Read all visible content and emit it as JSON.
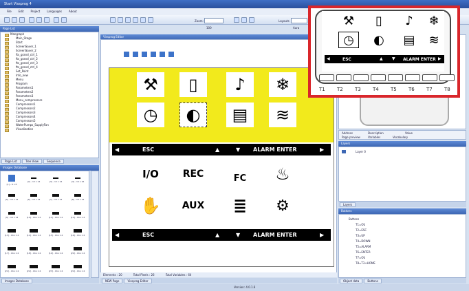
{
  "window": {
    "title": "Start Vissprog 4"
  },
  "menu": [
    "File",
    "Edit",
    "Project",
    "Languages",
    "About"
  ],
  "toolbar": {
    "zoom_label": "Zoom:",
    "zoom_value": "100",
    "layouts_label": "Layouts",
    "layouts_value": "Aura"
  },
  "page_list": {
    "title": "Page List",
    "items": [
      "Mangraph",
      "Main_Stage",
      "Start",
      "ScreenSaver_1",
      "ScreenSaver_2",
      "fts_grand_ctrl_1",
      "fts_grand_ctrl_2",
      "fts_grand_ctrl_3",
      "fts_grand_ctrl_4",
      "Set_Point",
      "Info_new",
      "Menu",
      "Program",
      "Parameters1",
      "Parameters2",
      "Parameters3",
      "Menu_compressors",
      "Compressors1",
      "Compressors2",
      "Compressors3",
      "Compressors4",
      "Compressors5",
      "WaterPumps_SupplyFan",
      "Visualization"
    ],
    "tabs": [
      "Page List",
      "Tree View",
      "Sequence"
    ]
  },
  "images_db": {
    "title": "Images Database",
    "captions": [
      "[1] - 8 x 8",
      "[2] - 10 x 14",
      "[3] - 10 x 14",
      "[4] - 16 x 16",
      "[5] - 16 x 14",
      "[6] - 16 x 14",
      "[7] - 16 x 14",
      "[8] - 16 x 14",
      "[9] - 16 x 14",
      "[10] - 16 x 14",
      "[11] - 16 x 14",
      "[12] - 16 x 14",
      "[13] - 16 x 14",
      "[14] - 16 x 14",
      "[15] - 16 x 14",
      "[16] - 16 x 14",
      "[17] - 16 x 14",
      "[18] - 16 x 14",
      "[19] - 16 x 14",
      "[20] - 16 x 14",
      "[21] - 16 x 14",
      "[22] - 16 x 14",
      "[23] - 16 x 14",
      "[24] - 16 x 14"
    ],
    "tab": "Images Database"
  },
  "editor": {
    "title": "Vissprog Editor",
    "bar1": {
      "esc": "ESC",
      "alarm_enter": "ALARM ENTER"
    },
    "bar2": {
      "esc": "ESC",
      "alarm_enter": "ALARM ENTER"
    },
    "big_icons": [
      "I/O",
      "REC",
      "FC",
      "AUX"
    ],
    "status": {
      "elements": "Elements : 20",
      "total_pixels": "Total Pixels : 26",
      "total_variables": "Total Variables : 64"
    },
    "bottom_tabs": [
      "NEW Page",
      "Vissprog Editor"
    ]
  },
  "right": {
    "props_cols": [
      "Address",
      "Description",
      "Value"
    ],
    "props_tabs": [
      "Page preview",
      "Variables",
      "Vocabulary"
    ],
    "layers_title": "Layers",
    "layer_item": "Layer 0",
    "layers_tab": "Layers",
    "buttons_title": "Buttons",
    "buttons_root": "Buttons",
    "buttons": [
      "T1=OU",
      "T2=ESC",
      "T3=UP",
      "T4=DOWN",
      "T5=ALARM",
      "T6=ENTER",
      "T7=OU",
      "T8=T3+HOME"
    ],
    "bottom_tabs": [
      "Object data",
      "Buttons"
    ]
  },
  "callout": {
    "esc": "ESC",
    "alarm_enter": "ALARM ENTER",
    "t_labels": [
      "T1",
      "T2",
      "T3",
      "T4",
      "T5",
      "T6",
      "T7",
      "T8"
    ]
  },
  "statusbar": {
    "version": "Version: 4.0.1.6"
  },
  "colors": {
    "accent_red": "#d9262b",
    "screen_yellow": "#f2ea1c"
  }
}
